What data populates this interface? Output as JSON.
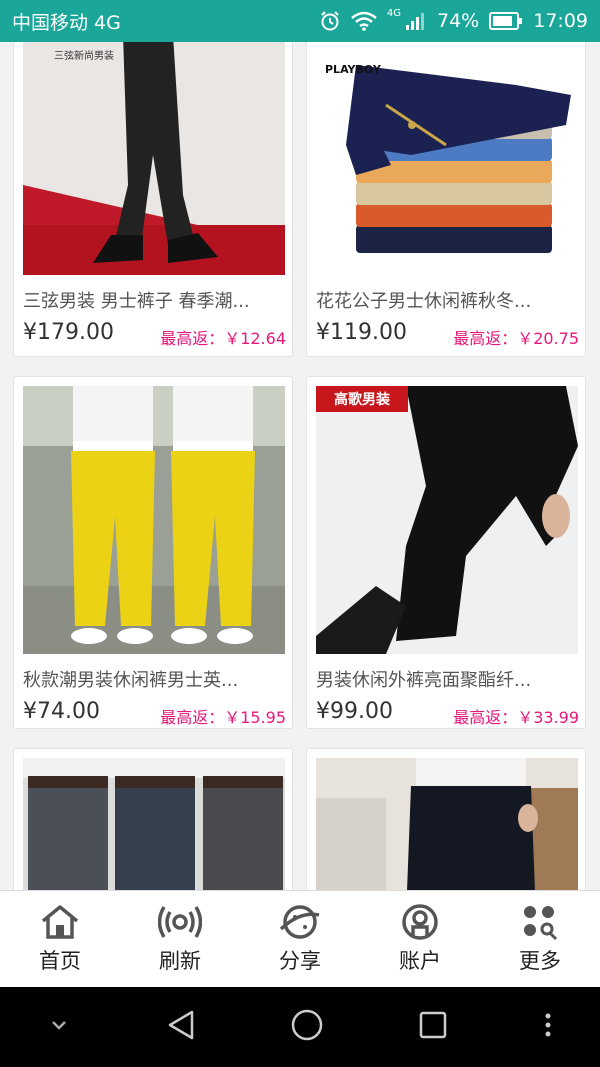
{
  "status": {
    "carrier": "中国移动 4G",
    "net_small": "4G",
    "battery": "74%",
    "time": "17:09"
  },
  "products": [
    {
      "title": "三弦男装 男士裤子 春季潮...",
      "price": "¥179.00",
      "rebate": "最高返：￥12.64",
      "brand_text": "三弦新尚男装"
    },
    {
      "title": "花花公子男士休闲裤秋冬...",
      "price": "¥119.00",
      "rebate": "最高返：￥20.75",
      "brand_text": "PLAYBOY"
    },
    {
      "title": "秋款潮男装休闲裤男士英...",
      "price": "¥74.00",
      "rebate": "最高返：￥15.95"
    },
    {
      "title": "男装休闲外裤亮面聚酯纤...",
      "price": "¥99.00",
      "rebate": "最高返：￥33.99",
      "brand_text": "高歌男装"
    },
    {
      "title": "",
      "price": "",
      "rebate": ""
    },
    {
      "title": "",
      "price": "",
      "rebate": ""
    }
  ],
  "tabs": [
    {
      "label": "首页",
      "icon": "home-icon"
    },
    {
      "label": "刷新",
      "icon": "refresh-broadcast-icon"
    },
    {
      "label": "分享",
      "icon": "share-planet-icon"
    },
    {
      "label": "账户",
      "icon": "account-icon"
    },
    {
      "label": "更多",
      "icon": "more-grid-icon"
    }
  ],
  "colors": {
    "status_bar": "#1aa79a",
    "rebate": "#e8177b"
  }
}
